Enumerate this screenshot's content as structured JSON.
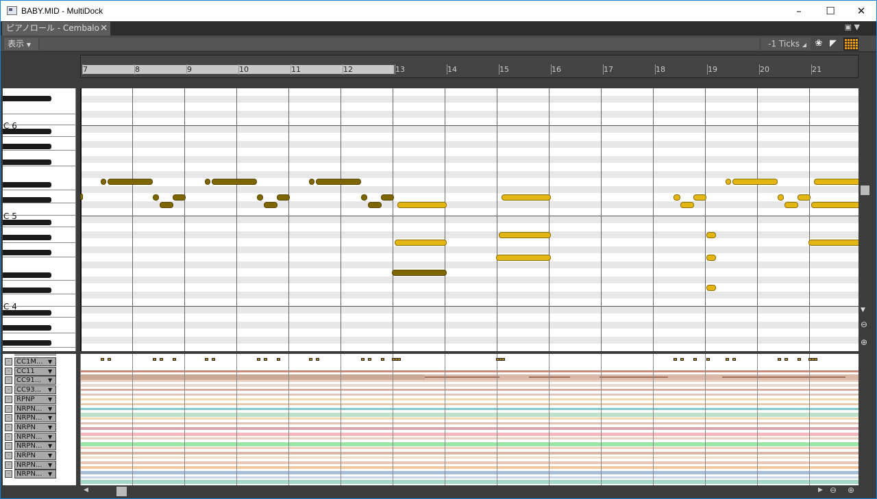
{
  "window": {
    "title": "BABY.MID - MultiDock"
  },
  "tab": {
    "label": "ピアノロール - Cembalo"
  },
  "toolbar": {
    "view_label": "表示",
    "ticks_label": "-1 Ticks"
  },
  "ruler": {
    "measures": [
      "7",
      "8",
      "9",
      "10",
      "11",
      "12",
      "13",
      "14",
      "15",
      "16",
      "17",
      "18",
      "19",
      "20",
      "21"
    ]
  },
  "keyboard": {
    "labels": [
      "C 6",
      "C 5",
      "C 4"
    ]
  },
  "controllers": [
    "CC1M...",
    "CC11",
    "CC91...",
    "CC93...",
    "RPNP",
    "NRPN...",
    "NRPN...",
    "NRPN",
    "NRPN...",
    "NRPN...",
    "NRPN",
    "NRPN...",
    "NRPN..."
  ],
  "colors": {
    "note_dark": "#7d6500",
    "note_light": "#e4b614",
    "grid_accent": "#f0a000"
  }
}
